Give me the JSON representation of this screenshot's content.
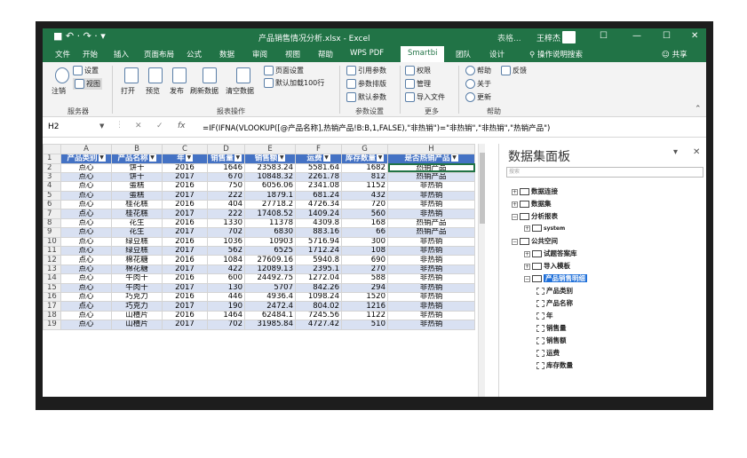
{
  "titlebar": {
    "qat": "■ ↶ · ↷ · ▾",
    "filename": "产品销售情况分析.xlsx  -  Excel",
    "tool_tab": "表格...",
    "user": "王梓杰",
    "ctrl_restore": "☐",
    "ctrl_min": "—",
    "ctrl_max": "☐",
    "ctrl_close": "✕"
  },
  "tabs": [
    "文件",
    "开始",
    "插入",
    "页面布局",
    "公式",
    "数据",
    "审阅",
    "视图",
    "帮助",
    "WPS PDF",
    "Smartbi",
    "团队",
    "设计",
    "操作说明搜索",
    "共享"
  ],
  "ribbon": {
    "settings": "设置",
    "view": "视图",
    "logout": "注销",
    "open": "打开",
    "preview": "预览",
    "publish": "发布",
    "refresh": "刷新数据",
    "clear": "清空数据",
    "page_setup": "页面设置",
    "default_load": "默认加载100行",
    "ref_param": "引用参数",
    "param_layout": "参数排版",
    "default_param": "默认参数",
    "permission": "权限",
    "manage": "管理",
    "import_file": "导入文件",
    "help": "帮助",
    "feedback": "反馈",
    "about": "关于",
    "update": "更新",
    "grp_service": "服务器",
    "grp_report": "报表操作",
    "grp_param": "参数设置",
    "grp_more": "更多",
    "grp_help": "帮助"
  },
  "formula_bar": {
    "namebox": "H2",
    "cancel": "✕",
    "confirm": "✓",
    "fx": "fx",
    "formula": "=IF(IFNA(VLOOKUP([@产品名称],热销产品!B:B,1,FALSE),\"非热销\")=\"非热销\",\"非热销\",\"热销产品\")"
  },
  "sheet": {
    "col_letters": [
      "A",
      "B",
      "C",
      "D",
      "E",
      "F",
      "G",
      "H"
    ],
    "headers": [
      "产品类别",
      "产品名称",
      "年",
      "销售量",
      "销售额",
      "运费",
      "库存数量",
      "是否热销产品"
    ],
    "header_display": [
      "产品类别",
      "产品名称",
      "年",
      "销售量",
      "销售额",
      "运费",
      "库存数量",
      "是否热销产品"
    ],
    "rows": [
      [
        "点心",
        "饼干",
        "2016",
        "1646",
        "23583.24",
        "5581.64",
        "1682",
        "热销产品"
      ],
      [
        "点心",
        "饼干",
        "2017",
        "670",
        "10848.32",
        "2261.78",
        "812",
        "热销产品"
      ],
      [
        "点心",
        "蛋糕",
        "2016",
        "750",
        "6056.06",
        "2341.08",
        "1152",
        "非热销"
      ],
      [
        "点心",
        "蛋糕",
        "2017",
        "222",
        "1879.1",
        "681.24",
        "432",
        "非热销"
      ],
      [
        "点心",
        "桂花糕",
        "2016",
        "404",
        "27718.2",
        "4726.34",
        "720",
        "非热销"
      ],
      [
        "点心",
        "桂花糕",
        "2017",
        "222",
        "17408.52",
        "1409.24",
        "560",
        "非热销"
      ],
      [
        "点心",
        "花生",
        "2016",
        "1330",
        "11378",
        "4309.8",
        "168",
        "热销产品"
      ],
      [
        "点心",
        "花生",
        "2017",
        "702",
        "6830",
        "883.16",
        "66",
        "热销产品"
      ],
      [
        "点心",
        "绿豆糕",
        "2016",
        "1036",
        "10903",
        "5716.94",
        "300",
        "非热销"
      ],
      [
        "点心",
        "绿豆糕",
        "2017",
        "562",
        "6525",
        "1712.24",
        "108",
        "非热销"
      ],
      [
        "点心",
        "棉花糖",
        "2016",
        "1084",
        "27609.16",
        "5940.8",
        "690",
        "非热销"
      ],
      [
        "点心",
        "棉花糖",
        "2017",
        "422",
        "12089.13",
        "2395.1",
        "270",
        "非热销"
      ],
      [
        "点心",
        "牛肉干",
        "2016",
        "600",
        "24492.75",
        "1272.04",
        "588",
        "非热销"
      ],
      [
        "点心",
        "牛肉干",
        "2017",
        "130",
        "5707",
        "842.26",
        "294",
        "非热销"
      ],
      [
        "点心",
        "巧克力",
        "2016",
        "446",
        "4936.4",
        "1098.24",
        "1520",
        "非热销"
      ],
      [
        "点心",
        "巧克力",
        "2017",
        "190",
        "2472.4",
        "804.02",
        "1216",
        "非热销"
      ],
      [
        "点心",
        "山楂片",
        "2016",
        "1464",
        "62484.1",
        "7245.56",
        "1122",
        "非热销"
      ],
      [
        "点心",
        "山楂片",
        "2017",
        "702",
        "31985.84",
        "4727.42",
        "510",
        "非热销"
      ]
    ]
  },
  "panel": {
    "title": "数据集面板",
    "dropdown": "▾",
    "close": "✕",
    "search_placeholder": "搜索",
    "tree": [
      {
        "label": "数据连接",
        "level": 0,
        "toggle": "+"
      },
      {
        "label": "数据集",
        "level": 0,
        "toggle": "+"
      },
      {
        "label": "分析报表",
        "level": 0,
        "toggle": "−"
      },
      {
        "label": "system",
        "level": 1,
        "toggle": "+"
      },
      {
        "label": "公共空间",
        "level": 0,
        "toggle": "−"
      },
      {
        "label": "试题答案库",
        "level": 1,
        "toggle": "+"
      },
      {
        "label": "导入模板",
        "level": 1,
        "toggle": "+"
      },
      {
        "label": "产品销售明细",
        "level": 1,
        "toggle": "−"
      },
      {
        "label": "产品类别",
        "level": 2,
        "toggle": ""
      },
      {
        "label": "产品名称",
        "level": 2,
        "toggle": ""
      },
      {
        "label": "年",
        "level": 2,
        "toggle": ""
      },
      {
        "label": "销售量",
        "level": 2,
        "toggle": ""
      },
      {
        "label": "销售额",
        "level": 2,
        "toggle": ""
      },
      {
        "label": "运费",
        "level": 2,
        "toggle": ""
      },
      {
        "label": "库存数量",
        "level": 2,
        "toggle": ""
      }
    ]
  },
  "colors": {
    "excel_green": "#217346",
    "table_header": "#4472c4",
    "band": "#d9e1f2",
    "tree_highlight": "#1e6fd9"
  }
}
